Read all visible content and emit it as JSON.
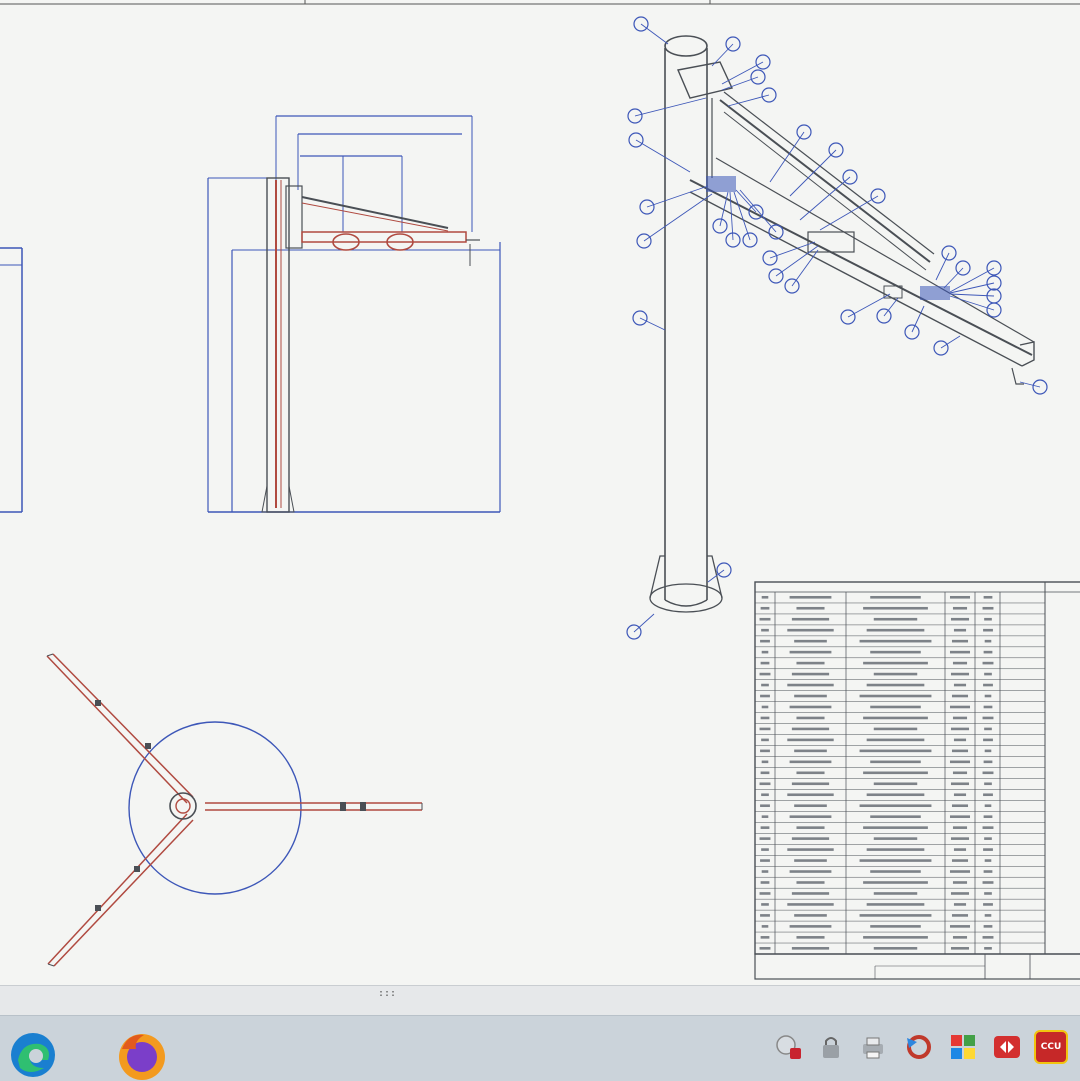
{
  "status_bar": {
    "grip": ":::"
  },
  "taskbar": {
    "apps": [
      {
        "name": "edge-icon",
        "color": "#1a7fd0"
      },
      {
        "name": "firefox-icon",
        "color": "#e25a1c"
      }
    ],
    "tray": [
      {
        "name": "shield-lock-icon",
        "color": "#c8242f"
      },
      {
        "name": "lock-icon",
        "color": "#666666"
      },
      {
        "name": "printer-icon",
        "color": "#777777"
      },
      {
        "name": "sync-icon",
        "color": "#c0392b"
      },
      {
        "name": "windows-grid-icon",
        "color": "#2e7d32"
      },
      {
        "name": "remote-icon",
        "color": "#d32f2f"
      },
      {
        "name": "ccu-icon",
        "label": "CCU",
        "color": "#c62828"
      }
    ]
  },
  "colors": {
    "dimension": "#3d57b8",
    "outline": "#4a4f55",
    "part": "#b04a40",
    "balloon": "#3d57b8"
  }
}
